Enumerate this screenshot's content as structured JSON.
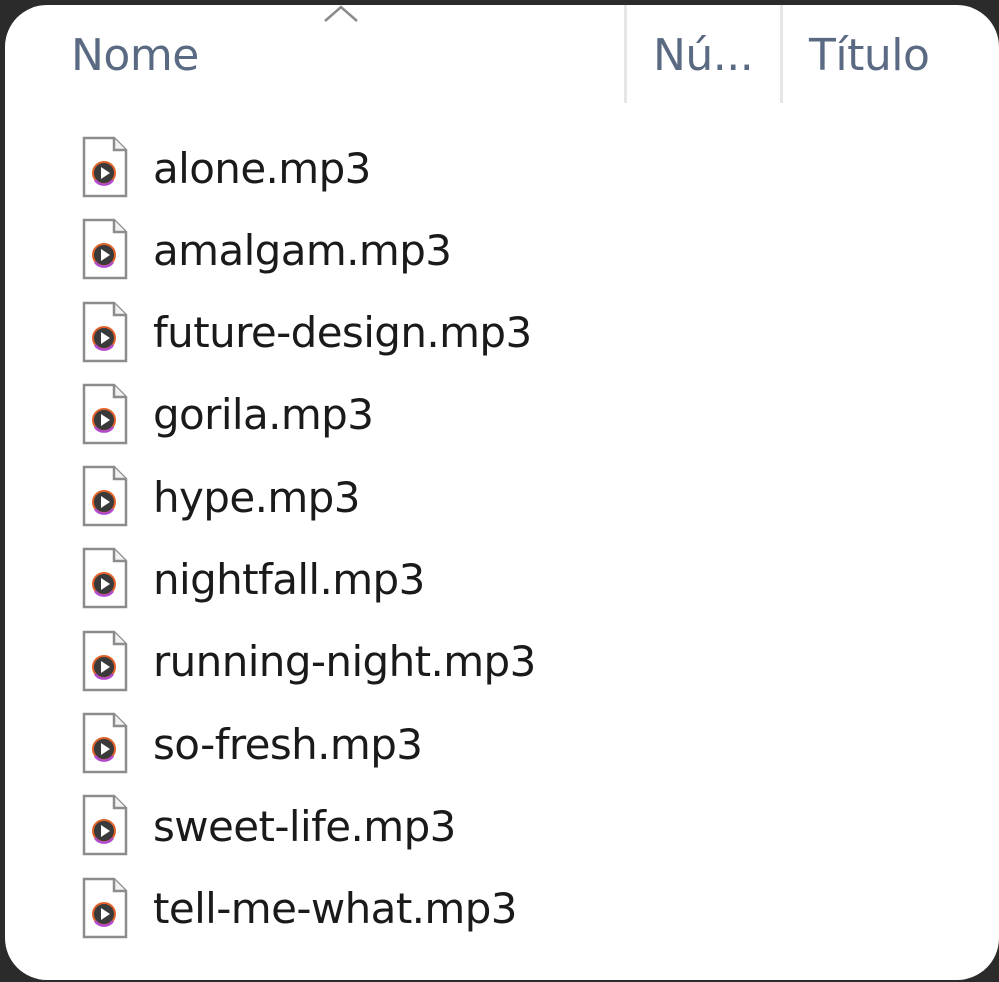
{
  "header": {
    "columns": [
      {
        "label": "Nome"
      },
      {
        "label": "Nú..."
      },
      {
        "label": "Título"
      }
    ]
  },
  "files": [
    {
      "name": "alone.mp3"
    },
    {
      "name": "amalgam.mp3"
    },
    {
      "name": "future-design.mp3"
    },
    {
      "name": "gorila.mp3"
    },
    {
      "name": "hype.mp3"
    },
    {
      "name": "nightfall.mp3"
    },
    {
      "name": "running-night.mp3"
    },
    {
      "name": "so-fresh.mp3"
    },
    {
      "name": "sweet-life.mp3"
    },
    {
      "name": "tell-me-what.mp3"
    }
  ],
  "icons": {
    "sort": "chevron-up-icon",
    "file": "audio-file-icon"
  },
  "colors": {
    "background": "#2b2b2b",
    "panel": "#ffffff",
    "header_text": "#5a6a82",
    "file_text": "#1a1a1a",
    "icon_accent": "#e0622a",
    "icon_accent_2": "#b24ad0"
  }
}
